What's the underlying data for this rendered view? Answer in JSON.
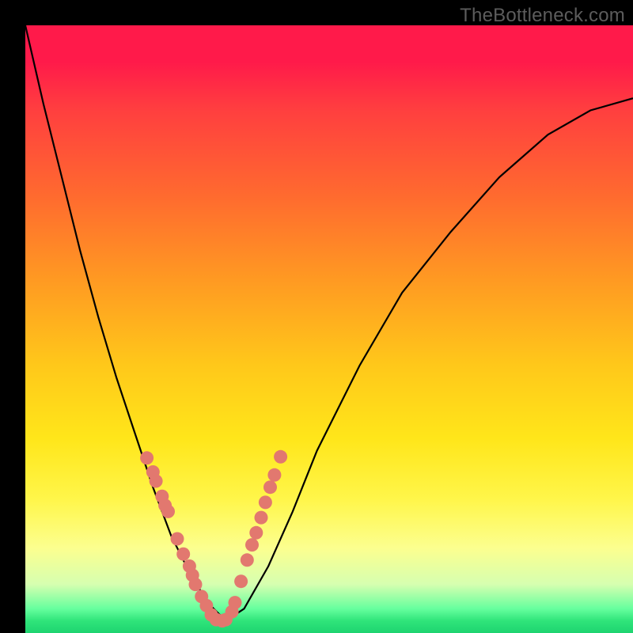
{
  "watermark": "TheBottleneck.com",
  "chart_data": {
    "type": "line",
    "title": "",
    "xlabel": "",
    "ylabel": "",
    "xlim": [
      0,
      1
    ],
    "ylim": [
      0,
      1
    ],
    "series": [
      {
        "name": "bottleneck-curve",
        "x": [
          0.0,
          0.03,
          0.06,
          0.09,
          0.12,
          0.15,
          0.18,
          0.21,
          0.24,
          0.27,
          0.3,
          0.33,
          0.36,
          0.4,
          0.44,
          0.48,
          0.55,
          0.62,
          0.7,
          0.78,
          0.86,
          0.93,
          1.0
        ],
        "y": [
          1.0,
          0.87,
          0.75,
          0.63,
          0.52,
          0.42,
          0.33,
          0.24,
          0.16,
          0.1,
          0.05,
          0.02,
          0.04,
          0.11,
          0.2,
          0.3,
          0.44,
          0.56,
          0.66,
          0.75,
          0.82,
          0.86,
          0.88
        ]
      }
    ],
    "markers": {
      "name": "highlighted-points",
      "color": "#e2786f",
      "x": [
        0.2,
        0.21,
        0.215,
        0.225,
        0.23,
        0.235,
        0.25,
        0.26,
        0.27,
        0.275,
        0.28,
        0.29,
        0.298,
        0.306,
        0.314,
        0.324,
        0.33,
        0.34,
        0.345,
        0.355,
        0.365,
        0.373,
        0.38,
        0.388,
        0.395,
        0.403,
        0.41,
        0.42
      ],
      "y": [
        0.288,
        0.265,
        0.25,
        0.225,
        0.21,
        0.2,
        0.155,
        0.13,
        0.11,
        0.095,
        0.08,
        0.06,
        0.045,
        0.03,
        0.022,
        0.02,
        0.022,
        0.035,
        0.05,
        0.085,
        0.12,
        0.145,
        0.165,
        0.19,
        0.215,
        0.24,
        0.26,
        0.29
      ]
    },
    "gradient_stops": [
      {
        "pos": 0.0,
        "color": "#ff1a4a"
      },
      {
        "pos": 0.06,
        "color": "#ff1a4a"
      },
      {
        "pos": 0.14,
        "color": "#ff3f3f"
      },
      {
        "pos": 0.28,
        "color": "#ff6a2f"
      },
      {
        "pos": 0.42,
        "color": "#ff9a22"
      },
      {
        "pos": 0.56,
        "color": "#ffc81a"
      },
      {
        "pos": 0.68,
        "color": "#ffe61a"
      },
      {
        "pos": 0.78,
        "color": "#fff64a"
      },
      {
        "pos": 0.86,
        "color": "#fcff8f"
      },
      {
        "pos": 0.92,
        "color": "#d6ffb0"
      },
      {
        "pos": 0.96,
        "color": "#66ff9e"
      },
      {
        "pos": 0.98,
        "color": "#2fe47a"
      },
      {
        "pos": 1.0,
        "color": "#1ed470"
      }
    ]
  }
}
